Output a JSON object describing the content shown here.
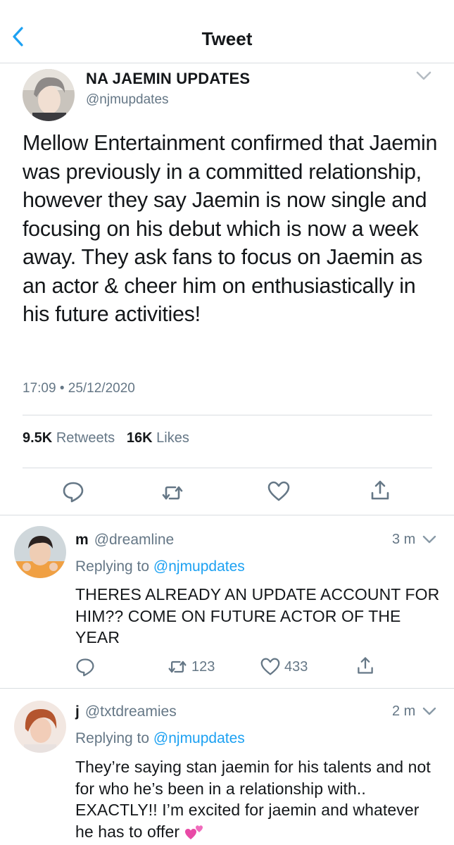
{
  "colors": {
    "accent": "#1da1f2",
    "secondary_text": "#657786",
    "primary_text": "#14171a",
    "divider": "#d9dde1"
  },
  "header": {
    "title": "Tweet",
    "back_icon": "chevron-left-icon"
  },
  "tweet": {
    "author_name": "NA JAEMIN UPDATES",
    "author_handle": "@njmupdates",
    "text": "Mellow Entertainment confirmed that Jaemin was previously in a committed relationship, however they say Jaemin is now single and focusing on his debut which is now a week away. They ask fans to focus on Jaemin as an actor & cheer him on enthusiastically in his future activities!",
    "timestamp": "17:09 • 25/12/2020",
    "retweets_count": "9.5K",
    "retweets_label": "Retweets",
    "likes_count": "16K",
    "likes_label": "Likes",
    "actions": [
      "reply-icon",
      "retweet-icon",
      "like-icon",
      "share-icon"
    ]
  },
  "replies": [
    {
      "name": "m",
      "handle": "@dreamline",
      "time": "3 m",
      "replying_prefix": "Replying to",
      "replying_to": "@njmupdates",
      "text": "THERES ALREADY AN UPDATE ACCOUNT FOR HIM?? COME ON FUTURE ACTOR OF THE YEAR",
      "retweets": "123",
      "likes": "433"
    },
    {
      "name": "j",
      "handle": "@txtdreamies",
      "time": "2 m",
      "replying_prefix": "Replying to",
      "replying_to": "@njmupdates",
      "text": "They’re saying stan jaemin for his talents and not for who he’s been in a relationship with.. EXACTLY!! I’m excited for jaemin and whatever he has to offer",
      "emoji": "two-hearts-emoji"
    }
  ]
}
